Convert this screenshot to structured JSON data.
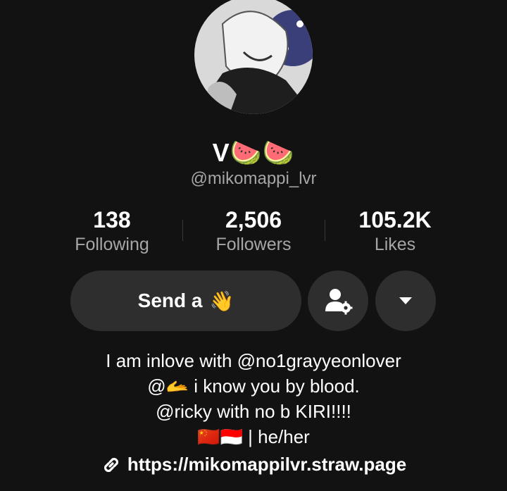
{
  "profile": {
    "display_name": "V🍉🍉",
    "handle": "@mikomappi_lvr"
  },
  "stats": [
    {
      "value": "138",
      "label": "Following"
    },
    {
      "value": "2,506",
      "label": "Followers"
    },
    {
      "value": "105.2K",
      "label": "Likes"
    }
  ],
  "actions": {
    "send_label": "Send a",
    "wave_emoji": "👋",
    "person_settings_icon": "person-gear-icon",
    "dropdown_icon": "caret-down-icon"
  },
  "bio": {
    "line1": "I am inlove with @no1grayyeonlover",
    "line2": "@🫴 i know you by blood.",
    "line3": "@ricky with no b KIRI!!!!",
    "line4": "🇨🇳🇮🇩 | he/her"
  },
  "link": {
    "url": "https://mikomappilvr.straw.page",
    "icon": "link-icon"
  },
  "colors": {
    "background": "#121212",
    "button": "#2e2e2e",
    "muted_text": "#a6a6a6"
  }
}
